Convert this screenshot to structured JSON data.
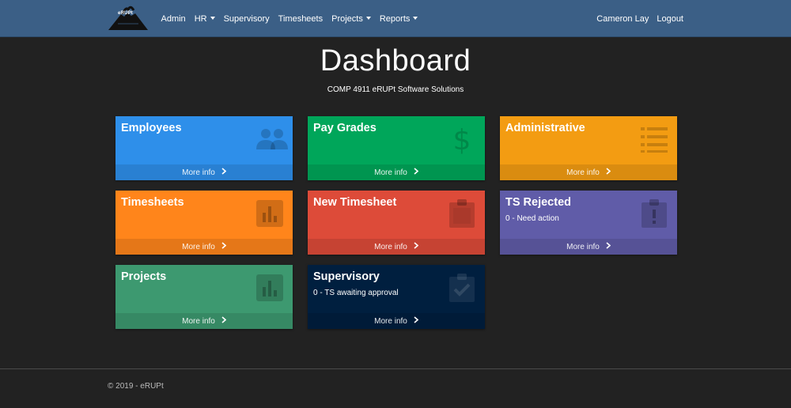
{
  "navbar": {
    "brand_text": "eRUPt",
    "left_items": [
      {
        "label": "Admin",
        "dropdown": false
      },
      {
        "label": "HR",
        "dropdown": true
      },
      {
        "label": "Supervisory",
        "dropdown": false
      },
      {
        "label": "Timesheets",
        "dropdown": false
      },
      {
        "label": "Projects",
        "dropdown": true
      },
      {
        "label": "Reports",
        "dropdown": true
      }
    ],
    "user_name": "Cameron Lay",
    "logout_label": "Logout"
  },
  "header": {
    "title": "Dashboard",
    "subtitle": "COMP 4911 eRUPt Software Solutions"
  },
  "cards": [
    {
      "title": "Employees",
      "sub": "",
      "footer": "More info",
      "color": "#2e8fea",
      "icon": "users-icon"
    },
    {
      "title": "Pay Grades",
      "sub": "",
      "footer": "More info",
      "color": "#00a65a",
      "icon": "dollar-icon"
    },
    {
      "title": "Administrative",
      "sub": "",
      "footer": "More info",
      "color": "#f39c12",
      "icon": "list-icon"
    },
    {
      "title": "Timesheets",
      "sub": "",
      "footer": "More info",
      "color": "#ff851b",
      "icon": "bar-chart-icon"
    },
    {
      "title": "New Timesheet",
      "sub": "",
      "footer": "More info",
      "color": "#dd4b39",
      "icon": "clipboard-icon"
    },
    {
      "title": "TS Rejected",
      "sub": "0 - Need action",
      "footer": "More info",
      "color": "#605ca8",
      "icon": "clipboard-alert-icon"
    },
    {
      "title": "Projects",
      "sub": "",
      "footer": "More info",
      "color": "#3d9970",
      "icon": "bar-chart-icon"
    },
    {
      "title": "Supervisory",
      "sub": "0 - TS awaiting approval",
      "footer": "More info",
      "color": "#001f3f",
      "icon": "clipboard-check-icon"
    }
  ],
  "footer": {
    "copyright": "© 2019 - eRUPt"
  }
}
